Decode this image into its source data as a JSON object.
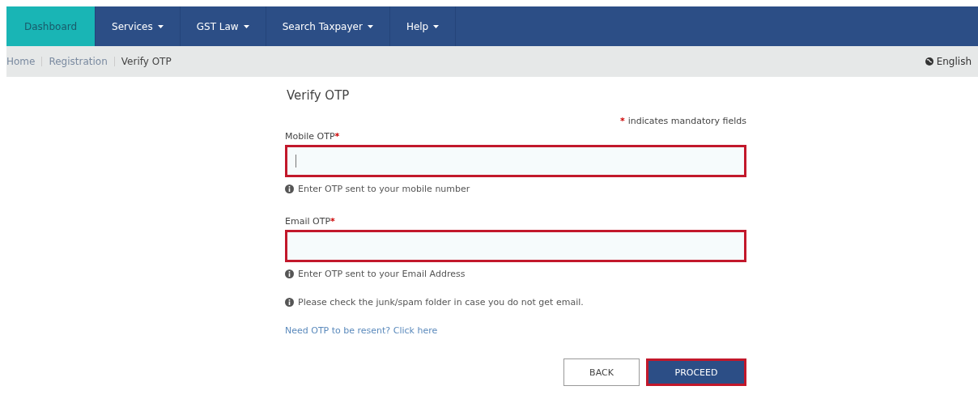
{
  "nav": [
    {
      "label": "Dashboard",
      "selected": true,
      "dropdown": false
    },
    {
      "label": "Services",
      "selected": false,
      "dropdown": true
    },
    {
      "label": "GST Law",
      "selected": false,
      "dropdown": true
    },
    {
      "label": "Search Taxpayer",
      "selected": false,
      "dropdown": true
    },
    {
      "label": "Help",
      "selected": false,
      "dropdown": true
    }
  ],
  "breadcrumb": [
    {
      "label": "Home",
      "current": false
    },
    {
      "label": "Registration",
      "current": false
    },
    {
      "label": "Verify OTP",
      "current": true
    }
  ],
  "language": "English",
  "form": {
    "title": "Verify OTP",
    "mandatory_mark": "*",
    "mandatory_note": "indicates mandatory fields",
    "fields": [
      {
        "label": "Mobile OTP",
        "required_mark": "*",
        "highlighted": true,
        "focused": true,
        "hint": "Enter OTP sent to your mobile number"
      },
      {
        "label": "Email OTP",
        "required_mark": "*",
        "highlighted": true,
        "focused": false,
        "hint": "Enter OTP sent to your Email Address"
      }
    ],
    "note": "Please check the junk/spam folder in case you do not get email.",
    "resend_link": "Need OTP to be resent? Click here",
    "buttons": [
      {
        "label": "BACK",
        "kind": "secondary",
        "highlighted": false
      },
      {
        "label": "PROCEED",
        "kind": "primary",
        "highlighted": true
      }
    ]
  }
}
